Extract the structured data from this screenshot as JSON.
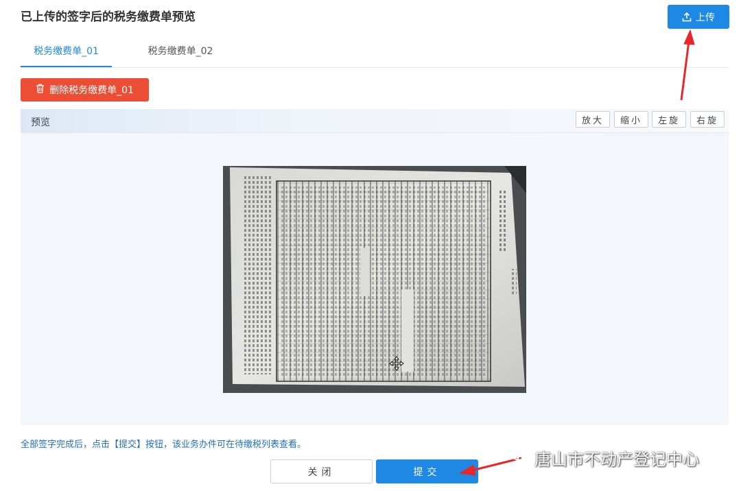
{
  "page": {
    "title": "已上传的签字后的税务缴费单预览",
    "upload_label": "上传"
  },
  "tabs": [
    {
      "label": "税务缴费单_01",
      "active": true
    },
    {
      "label": "税务缴费单_02",
      "active": false
    }
  ],
  "actions": {
    "delete_label": "删除税务缴费单_01"
  },
  "preview": {
    "label": "预览",
    "tools": {
      "zoom_in": "放大",
      "zoom_out": "缩小",
      "rotate_left": "左旋",
      "rotate_right": "右旋"
    }
  },
  "footer": {
    "hint": "全部签字完成后，点击【提交】按钮，该业务办件可在待缴税列表查看。",
    "close_label": "关闭",
    "submit_label": "提交"
  },
  "watermark": {
    "text": "唐山市不动产登记中心"
  },
  "colors": {
    "primary": "#1e88e5",
    "danger": "#ec4d35",
    "annotation_arrow": "#e8262b"
  },
  "icons": {
    "upload": "upload-icon",
    "delete": "trash-icon",
    "cursor": "move-cursor-icon",
    "watermark": "wechat-icon"
  }
}
